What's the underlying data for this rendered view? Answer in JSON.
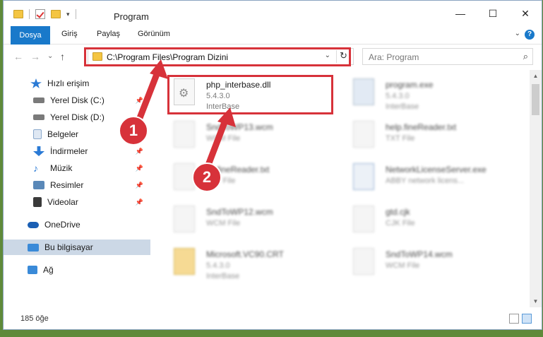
{
  "window": {
    "title": "Program",
    "minimize": "—",
    "maximize": "☐",
    "close": "✕"
  },
  "ribbon": {
    "tabs": [
      "Dosya",
      "Giriş",
      "Paylaş",
      "Görünüm"
    ],
    "help": "?"
  },
  "nav": {
    "back": "←",
    "forward": "→",
    "recent": "⌄",
    "up": "↑",
    "address": "C:\\Program Files\\Program Dizini",
    "search_placeholder": "Ara: Program"
  },
  "sidebar": {
    "items": [
      {
        "label": "Hızlı erişim",
        "icon": "star-icon",
        "color": "#2a7ad5"
      },
      {
        "label": "Yerel Disk (C:)",
        "icon": "drive-icon",
        "color": "#7a7a7a"
      },
      {
        "label": "Yerel Disk (D:)",
        "icon": "drive-icon",
        "color": "#7a7a7a"
      },
      {
        "label": "Belgeler",
        "icon": "documents-icon",
        "color": "#8aa9cc"
      },
      {
        "label": "İndirmeler",
        "icon": "download-icon",
        "color": "#2a7ad5"
      },
      {
        "label": "Müzik",
        "icon": "music-icon",
        "color": "#2a7ad5"
      },
      {
        "label": "Resimler",
        "icon": "pictures-icon",
        "color": "#5a88b8"
      },
      {
        "label": "Videolar",
        "icon": "videos-icon",
        "color": "#3a3a3a"
      },
      {
        "label": "OneDrive",
        "icon": "cloud-icon",
        "color": "#1a5fb4"
      },
      {
        "label": "Bu bilgisayar",
        "icon": "computer-icon",
        "color": "#3a8ad8"
      },
      {
        "label": "Ağ",
        "icon": "network-icon",
        "color": "#3a8ad8"
      }
    ]
  },
  "files": [
    {
      "name": "php_interbase.dll",
      "line2": "5.4.3.0",
      "line3": "InterBase"
    },
    {
      "name": "program.exe",
      "line2": "5.4.3.0",
      "line3": "InterBase"
    },
    {
      "name": "SndToWP13.wcm",
      "line2": "WCM File",
      "line3": ""
    },
    {
      "name": "help.fineReader.txt",
      "line2": "TXT File",
      "line3": ""
    },
    {
      "name": "LicfineReader.txt",
      "line2": "TXT File",
      "line3": ""
    },
    {
      "name": "NetworkLicenseServer.exe",
      "line2": "ABBY network licens...",
      "line3": ""
    },
    {
      "name": "SndToWP12.wcm",
      "line2": "WCM File",
      "line3": ""
    },
    {
      "name": "gtd.cjk",
      "line2": "CJK File",
      "line3": ""
    },
    {
      "name": "Microsoft.VC90.CRT",
      "line2": "5.4.3.0",
      "line3": "InterBase"
    },
    {
      "name": "SndToWP14.wcm",
      "line2": "WCM File",
      "line3": ""
    }
  ],
  "status": {
    "count": "185 öğe"
  },
  "annotations": {
    "step1": "1",
    "step2": "2"
  }
}
